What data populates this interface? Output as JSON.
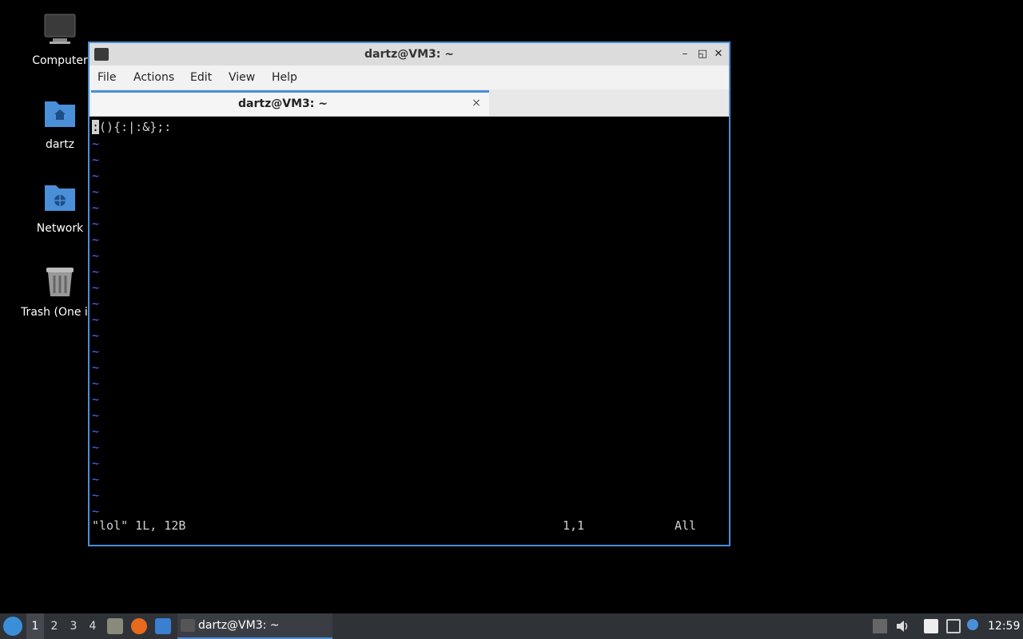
{
  "desktop": {
    "icons": [
      {
        "label": "Computer",
        "icon": "computer-icon"
      },
      {
        "label": "dartz",
        "icon": "home-folder-icon"
      },
      {
        "label": "Network",
        "icon": "network-folder-icon"
      },
      {
        "label": "Trash (One ite",
        "icon": "trash-icon"
      }
    ]
  },
  "window": {
    "title": "dartz@VM3: ~",
    "menu": [
      "File",
      "Actions",
      "Edit",
      "View",
      "Help"
    ],
    "tab_title": "dartz@VM3: ~",
    "tab_close": "×",
    "minimize": "–",
    "maximize": "◱",
    "close": "✕"
  },
  "terminal": {
    "cursor_char": ":",
    "line_rest": "(){:|:&};:",
    "tilde": "~",
    "status_file": "\"lol\" 1L, 12B",
    "status_pos": "1,1",
    "status_scroll": "All"
  },
  "taskbar": {
    "workspaces": [
      "1",
      "2",
      "3",
      "4"
    ],
    "active_workspace": "1",
    "task_label": "dartz@VM3: ~",
    "clock": "12:59"
  },
  "colors": {
    "accent": "#4a8fd8",
    "tilde": "#4d6bff",
    "taskbar": "#2f3338"
  }
}
